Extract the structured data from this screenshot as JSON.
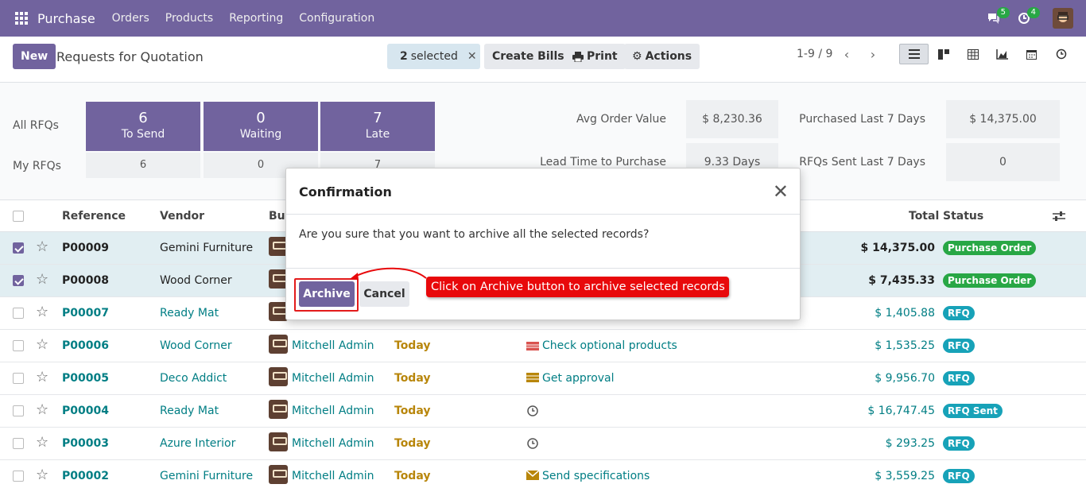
{
  "navbar": {
    "brand": "Purchase",
    "menu": [
      "Orders",
      "Products",
      "Reporting",
      "Configuration"
    ],
    "messages_count": "5",
    "activities_count": "4"
  },
  "control_panel": {
    "new_label": "New",
    "breadcrumb": "Requests for Quotation",
    "selected_count": "2",
    "selected_label": "selected",
    "create_bills": "Create Bills",
    "print": "Print",
    "actions": "Actions",
    "pager": "1-9 / 9"
  },
  "dashboard": {
    "all_rfqs_label": "All RFQs",
    "my_rfqs_label": "My RFQs",
    "tiles": [
      {
        "num": "6",
        "label": "To Send"
      },
      {
        "num": "0",
        "label": "Waiting"
      },
      {
        "num": "7",
        "label": "Late"
      }
    ],
    "my_values": [
      "6",
      "0",
      "7"
    ],
    "kpis": {
      "avg_order_value_label": "Avg Order Value",
      "avg_order_value": "$ 8,230.36",
      "purchased_7_label": "Purchased Last 7 Days",
      "purchased_7": "$ 14,375.00",
      "lead_time_label": "Lead Time to Purchase",
      "lead_time": "9.33 Days",
      "rfq_sent_label": "RFQs Sent Last 7 Days",
      "rfq_sent": "0"
    }
  },
  "list": {
    "headers": {
      "reference": "Reference",
      "vendor": "Vendor",
      "buyer": "Buy",
      "total": "Total",
      "status": "Status"
    },
    "rows": [
      {
        "ref": "P00009",
        "vendor": "Gemini Furniture",
        "buyer": "",
        "date": "",
        "activity": "",
        "total": "$ 14,375.00",
        "status": "Purchase Order"
      },
      {
        "ref": "P00008",
        "vendor": "Wood Corner",
        "buyer": "",
        "date": "",
        "activity": "",
        "total": "$ 7,435.33",
        "status": "Purchase Order"
      },
      {
        "ref": "P00007",
        "vendor": "Ready Mat",
        "buyer": "",
        "date": "",
        "activity": "",
        "total": "$ 1,405.88",
        "status": "RFQ"
      },
      {
        "ref": "P00006",
        "vendor": "Wood Corner",
        "buyer": "Mitchell Admin",
        "date": "Today",
        "activity": "Check optional products",
        "total": "$ 1,535.25",
        "status": "RFQ"
      },
      {
        "ref": "P00005",
        "vendor": "Deco Addict",
        "buyer": "Mitchell Admin",
        "date": "Today",
        "activity": "Get approval",
        "total": "$ 9,956.70",
        "status": "RFQ"
      },
      {
        "ref": "P00004",
        "vendor": "Ready Mat",
        "buyer": "Mitchell Admin",
        "date": "Today",
        "activity": "",
        "total": "$ 16,747.45",
        "status": "RFQ Sent"
      },
      {
        "ref": "P00003",
        "vendor": "Azure Interior",
        "buyer": "Mitchell Admin",
        "date": "Today",
        "activity": "",
        "total": "$ 293.25",
        "status": "RFQ"
      },
      {
        "ref": "P00002",
        "vendor": "Gemini Furniture",
        "buyer": "Mitchell Admin",
        "date": "Today",
        "activity": "Send specifications",
        "total": "$ 3,559.25",
        "status": "RFQ"
      }
    ]
  },
  "modal": {
    "title": "Confirmation",
    "message": "Are you sure that you want to archive all the selected records?",
    "archive": "Archive",
    "cancel": "Cancel"
  },
  "annotation": {
    "text": "Click on Archive button to archive selected records"
  }
}
